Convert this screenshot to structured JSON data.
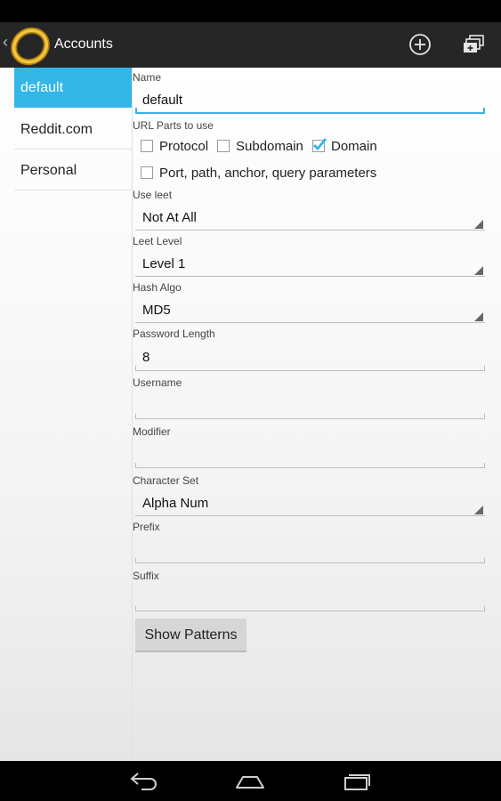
{
  "action_bar": {
    "title": "Accounts",
    "back_icon": "chevron-left",
    "logo_icon": "gold-ring-logo",
    "add_icon": "plus-circle",
    "windows_icon": "stacked-windows"
  },
  "accounts": [
    {
      "label": "default",
      "selected": true
    },
    {
      "label": "Reddit.com",
      "selected": false
    },
    {
      "label": "Personal",
      "selected": false
    }
  ],
  "form": {
    "name": {
      "label": "Name",
      "value": "default"
    },
    "url_parts": {
      "label": "URL Parts to use",
      "protocol": {
        "label": "Protocol",
        "checked": false
      },
      "subdomain": {
        "label": "Subdomain",
        "checked": false
      },
      "domain": {
        "label": "Domain",
        "checked": true
      },
      "port_path": {
        "label": "Port, path, anchor, query parameters",
        "checked": false
      }
    },
    "use_leet": {
      "label": "Use leet",
      "value": "Not At All"
    },
    "leet_level": {
      "label": "Leet Level",
      "value": "Level 1"
    },
    "hash_algo": {
      "label": "Hash Algo",
      "value": "MD5"
    },
    "password_length": {
      "label": "Password Length",
      "value": "8"
    },
    "username": {
      "label": "Username",
      "value": ""
    },
    "modifier": {
      "label": "Modifier",
      "value": ""
    },
    "character_set": {
      "label": "Character Set",
      "value": "Alpha Num"
    },
    "prefix": {
      "label": "Prefix",
      "value": ""
    },
    "suffix": {
      "label": "Suffix",
      "value": ""
    },
    "show_patterns_button": "Show Patterns"
  },
  "nav": {
    "back_icon": "back-arrow",
    "home_icon": "home",
    "recents_icon": "recent-apps"
  },
  "colors": {
    "accent": "#33b5e5",
    "action_bar": "#262626"
  }
}
